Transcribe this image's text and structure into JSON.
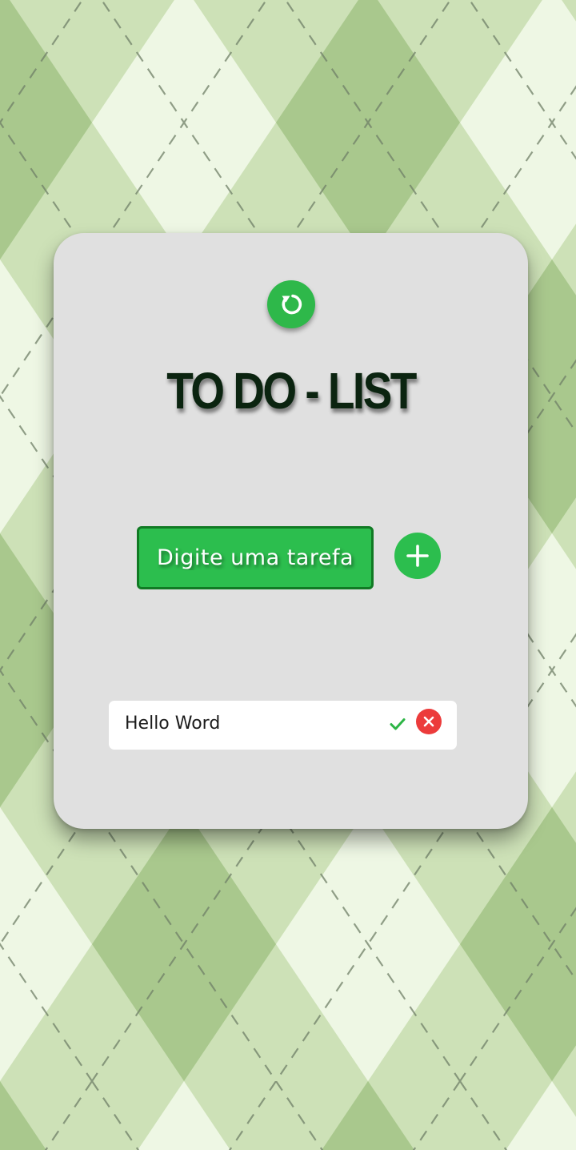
{
  "app": {
    "title": "TO DO - LIST"
  },
  "icons": {
    "refresh": "refresh-icon",
    "add": "plus-icon",
    "complete": "check-icon",
    "delete": "close-icon"
  },
  "input": {
    "placeholder": "Digite uma tarefa",
    "value": ""
  },
  "tasks": [
    {
      "text": "Hello Word"
    }
  ],
  "colors": {
    "accent": "#2cbe4e",
    "title": "#0b2410",
    "card": "#e0e0e0",
    "delete": "#ec3b3b",
    "background_light": "#eef7e4",
    "background_mid": "#cde1b7",
    "background_dark": "#a9c88d"
  }
}
